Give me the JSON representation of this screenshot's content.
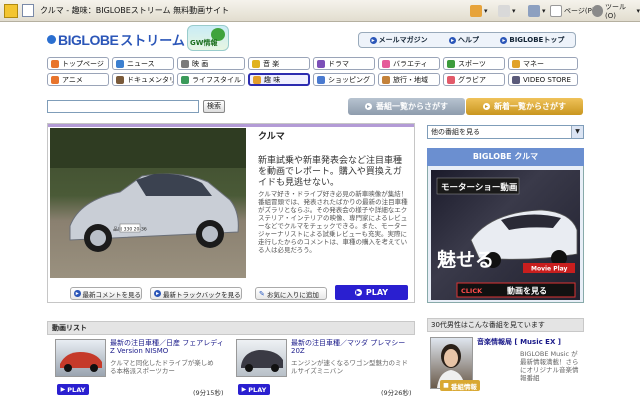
{
  "browser": {
    "title": "クルマ - 趣味：BIGLOBEストリーム 無料動画サイト",
    "page_menu": "ページ(P)",
    "tools_menu": "ツール(O)"
  },
  "header": {
    "logo_text": "BIGLOBE",
    "logo_sub": "ストリーム",
    "gw_label": "GW情報",
    "links": [
      {
        "label": "メールマガジン"
      },
      {
        "label": "ヘルプ"
      },
      {
        "label": "BIGLOBEトップ"
      }
    ]
  },
  "nav": {
    "row1": [
      {
        "label": "トップページ",
        "color": "#e8742c"
      },
      {
        "label": "ニュース",
        "color": "#3b7fd0"
      },
      {
        "label": "映 画",
        "color": "#7a7a7a"
      },
      {
        "label": "音 楽",
        "color": "#e0b21e"
      },
      {
        "label": "ドラマ",
        "color": "#7c4fb8"
      },
      {
        "label": "バラエティ",
        "color": "#e55a9a"
      },
      {
        "label": "スポーツ",
        "color": "#3c9c3c"
      },
      {
        "label": "マネー",
        "color": "#e0a22a"
      }
    ],
    "row2": [
      {
        "label": "アニメ",
        "color": "#e8742c"
      },
      {
        "label": "ドキュメンタリー",
        "color": "#7a5a3a"
      },
      {
        "label": "ライフスタイル",
        "color": "#3a9a5a"
      },
      {
        "label": "趣 味",
        "color": "#e39e2a"
      },
      {
        "label": "ショッピング",
        "color": "#4a7ad0"
      },
      {
        "label": "旅行・地域",
        "color": "#c4823a"
      },
      {
        "label": "グラビア",
        "color": "#e25a6a"
      },
      {
        "label": "VIDEO STORE",
        "color": "#5a5a7a"
      }
    ],
    "selected": "趣 味"
  },
  "search": {
    "value": "",
    "button_label": "検索",
    "program_list_label": "番組一覧からさがす",
    "new_list_label": "新着一覧からさがす"
  },
  "feature": {
    "title": "クルマ",
    "lead": "新車試乗や新車発表会など注目車種を動画でレポート。購入や買換えガイドも見逃せない。",
    "body": "クルマ好き・ドライブ好き必見の新車映像が集結！番組冒頭では、発表されたばかりの最新の注目車種がズラリとならぶ。その発表会の様子や詳細なエクステリア・インテリアの映像、専門家によるレビューなどでクルマをチェックできる。また、モータージャーナリストによる試乗レビューも充実。実際に走行したからのコメントは、車種の購入を考えている人は必見だろう。",
    "plate": "品川 330\n20-36",
    "buttons": {
      "comments": "最新コメントを見る",
      "trackback": "最新トラックバックを見る",
      "favorite": "お気に入りに追加",
      "play": "PLAY"
    }
  },
  "sidebar": {
    "other_select": "他の番組を見る",
    "box_title": "BIGLOBE クルマ",
    "banner": {
      "headline": "モーターショー動画",
      "big_text": "魅せる",
      "movie_play": "Movie Play",
      "click": "CLICK",
      "cta": "動画を見る"
    },
    "rec_header": "30代男性はこんな番組を見ています",
    "rec_title": "音楽情報局 [ Music EX ]",
    "rec_desc": "BIGLOBE Music が最新情報満載！さらにオリジナル音楽情報番組",
    "rec_button": "番組情報"
  },
  "video_list": {
    "header": "動画リスト",
    "items": [
      {
        "title": "最新の注目車種／日産 フェアレディZ Version NISMO",
        "desc": "クルマと同化したドライブが楽しめる本格派スポーツカー",
        "duration": "(9分15秒)",
        "play": "PLAY"
      },
      {
        "title": "最新の注目車種／マツダ プレマシー20Z",
        "desc": "エンジンが速くなるワゴン型魅力のミドルサイズミニバン",
        "duration": "(9分26秒)",
        "play": "PLAY"
      }
    ]
  },
  "colors": {
    "accent_blue": "#2a1fd0",
    "nav_selected": "#2c2cb0",
    "list_btn_grey": "#9aa8b8",
    "list_btn_gold": "#d9a832"
  },
  "icons": {
    "browser": [
      "favorites-star-icon",
      "tab-page-icon",
      "home-icon",
      "feed-icon",
      "print-icon",
      "page-icon",
      "tools-icon"
    ],
    "arrows": "circle-arrow-icon"
  }
}
